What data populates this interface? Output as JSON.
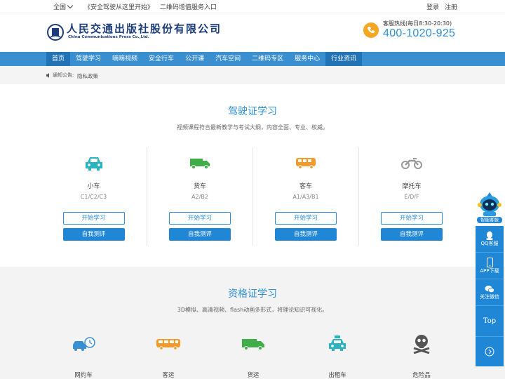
{
  "topbar": {
    "region": "全国",
    "promo_title": "《安全驾驶从这里开始》",
    "promo_link": "二维码增值服务入口",
    "login": "登录",
    "register": "注册"
  },
  "header": {
    "logo_cn": "人民交通出版社股份有限公司",
    "logo_en": "China Communications Press Co.,Ltd.",
    "hotline_label": "客服热线(每日8:30-20:30)",
    "hotline_number": "400-1020-925"
  },
  "nav": {
    "items": [
      "首页",
      "驾驶学习",
      "嘀嘀视频",
      "安全行车",
      "公开课",
      "汽车空间",
      "二维码专区",
      "服务中心",
      "行业资讯"
    ]
  },
  "notice": {
    "label": "通知公告:",
    "text": "隐私政策"
  },
  "driving": {
    "title": "驾驶证学习",
    "subtitle": "视频课程符合最新教学与考试大纲，内容全面、专业、权威。",
    "cards": [
      {
        "name": "小车",
        "code": "C1/C2/C3",
        "icon": "car-icon",
        "color": "#2bb3c0"
      },
      {
        "name": "货车",
        "code": "A2/B2",
        "icon": "truck-icon",
        "color": "#3fae49"
      },
      {
        "name": "客车",
        "code": "A1/A3/B1",
        "icon": "bus-icon",
        "color": "#f39a2b"
      },
      {
        "name": "摩托车",
        "code": "E/D/F",
        "icon": "motorcycle-icon",
        "color": "#999999"
      }
    ],
    "start_label": "开始学习",
    "test_label": "自我测评"
  },
  "qualification": {
    "title": "资格证学习",
    "subtitle": "3D模拟、高清视频、flash动画多形式，将理论知识可视化。",
    "items": [
      {
        "name": "网约车",
        "icon": "ride-hailing-icon"
      },
      {
        "name": "客运",
        "icon": "coach-icon"
      },
      {
        "name": "货运",
        "icon": "freight-icon"
      },
      {
        "name": "出租车",
        "icon": "taxi-icon"
      },
      {
        "name": "危险品",
        "icon": "hazard-icon"
      }
    ]
  },
  "side": {
    "robot_label": "智能客服",
    "qq": "QQ客服",
    "app": "APP下载",
    "wechat": "关注微信",
    "top": "Top"
  }
}
